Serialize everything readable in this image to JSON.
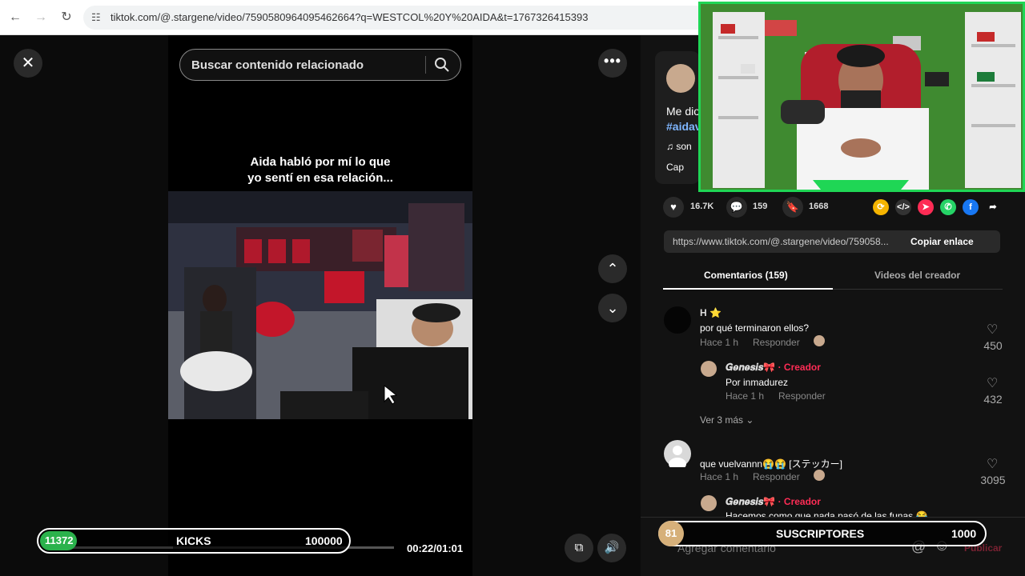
{
  "browser": {
    "url": "tiktok.com/@.stargene/video/7590580964095462664?q=WESTCOL%20Y%20AIDA&t=1767326415393",
    "back": "←",
    "forward": "→",
    "reload": "↻"
  },
  "player": {
    "close": "✕",
    "search_placeholder": "Buscar contenido relacionado",
    "more": "•••",
    "caption_line1": "Aida habló por mí lo que",
    "caption_line2": "yo sentí en esa relación...",
    "up": "⌃",
    "down": "⌄",
    "time": "00:22/01:01",
    "progress": 0.36
  },
  "description": {
    "text": "Me dio",
    "hashtag": "#aidav",
    "sound": "♫ son",
    "cap": "Cap"
  },
  "stats": {
    "likes": "16.7K",
    "comments": "159",
    "saves": "1668"
  },
  "link": {
    "url": "https://www.tiktok.com/@.stargene/video/759058...",
    "copy_label": "Copiar enlace"
  },
  "tabs": {
    "comments": "Comentarios (159)",
    "creator_videos": "Videos del creador"
  },
  "comments": [
    {
      "user": "H ⭐",
      "text": "por qué terminaron ellos?",
      "time": "Hace 1 h",
      "reply": "Responder",
      "likes": "450",
      "replies": [
        {
          "user": "𝑮𝒆𝒏𝒆𝒔𝒊𝒔🎀",
          "tag": " · Creador",
          "text": "Por inmadurez",
          "time": "Hace 1 h",
          "reply": "Responder",
          "likes": "432"
        }
      ],
      "more": "Ver 3 más ⌄"
    },
    {
      "user": "",
      "text": "que vuelvannn😭😭 [ステッカー]",
      "time": "Hace 1 h",
      "reply": "Responder",
      "likes": "3095",
      "replies": [
        {
          "user": "𝑮𝒆𝒏𝒆𝒔𝒊𝒔🎀",
          "tag": " · Creador",
          "text": "Hacemos como que nada pasó de las funas 😂"
        }
      ]
    }
  ],
  "comment_input": {
    "placeholder": "Agregar comentario",
    "at": "@",
    "emoji": "☺",
    "post": "Publicar"
  },
  "overlays": {
    "kicks": {
      "current": "11372",
      "label": "KICKS",
      "goal": "100000"
    },
    "subs": {
      "current": "81",
      "label": "SUSCRIPTORES",
      "goal": "1000"
    }
  },
  "colors": {
    "accent": "#fe2c55",
    "kicks_green": "#2bb24c",
    "subs_gold": "#d6b07a",
    "webcam_border": "#1fd655"
  }
}
